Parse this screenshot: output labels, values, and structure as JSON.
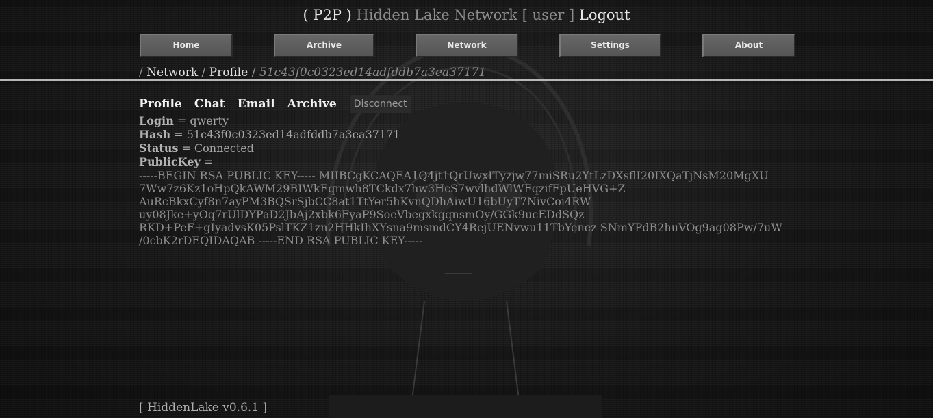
{
  "header": {
    "prefix": "( P2P )",
    "network_name": "Hidden Lake Network",
    "user_label": "[ user ]",
    "logout_label": "Logout"
  },
  "nav": {
    "home": "Home",
    "archive": "Archive",
    "network": "Network",
    "settings": "Settings",
    "about": "About"
  },
  "breadcrumb": {
    "sep1": "/ ",
    "network": "Network",
    "sep2": " / ",
    "profile": "Profile",
    "sep3": " / ",
    "hash": "51c43f0c0323ed14adfddb7a3ea37171"
  },
  "tabs": {
    "profile": "Profile",
    "chat": "Chat",
    "email": "Email",
    "archive": "Archive",
    "disconnect": "Disconnect"
  },
  "profile": {
    "login_key": "Login",
    "login_value": " = qwerty",
    "hash_key": "Hash",
    "hash_value": " = 51c43f0c0323ed14adfddb7a3ea37171",
    "status_key": "Status",
    "status_value": " = Connected",
    "publickey_key": "PublicKey",
    "publickey_eq": " ="
  },
  "public_key_lines": [
    "-----BEGIN RSA PUBLIC KEY----- MIIBCgKCAQEA1Q4jt1QrUwxITyzjw77miSRu2YtLzDXsflI20IXQaTjNsM20MgXU",
    "7Ww7z6Kz1oHpQkAWM29BIWkEqmwh8TCkdx7hw3HcS7wvlhdWlWFqzifFpUeHVG+Z",
    "AuRcBkxCyf8n7ayPM3BQSrSjbCC8at1TtYer5hKvnQDhAiwU16bUyT7NivCoi4RW",
    "uy08Jke+yOq7rUlDYPaD2JbAj2xbk6FyaP9SoeVbegxkgqnsmOy/GGk9ucEDdSQz",
    "RKD+PeF+gIyadvsK05PslTKZ1zn2HHkIhXYsna9msmdCY4RejUENvwu11TbYenez SNmYPdB2huVOg9ag08Pw/7uW",
    "/0cbK2rDEQIDAQAB -----END RSA PUBLIC KEY-----"
  ],
  "footer": {
    "version": "[ HiddenLake v0.6.1 ]"
  },
  "colors": {
    "background": "#141414",
    "text_bright": "#e6e6e6",
    "text_dim": "#8c8c8c",
    "button_face": "#5e5e5e"
  }
}
